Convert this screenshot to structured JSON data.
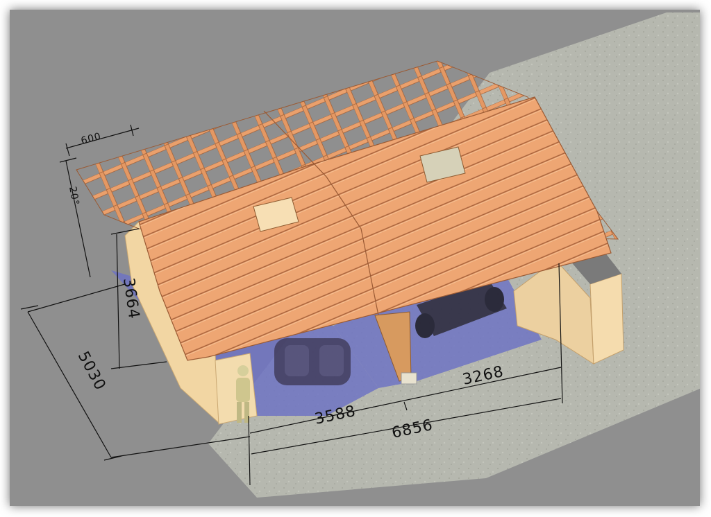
{
  "image": {
    "subject": "garage",
    "dimensions": {
      "rafter_spacing": "600",
      "roof_height": "20°",
      "wall_height": "3664",
      "depth": "5030",
      "left_bay_width": "3588",
      "right_bay_width": "3268",
      "total_width": "6856"
    },
    "colors": {
      "background": "#8f8f8f",
      "concrete": "#b5b7ae",
      "wall": "#f2d6a3",
      "wall_shadow": "#e3bf86",
      "roof": "#e9a06e",
      "floor_zone": "#6f73c3"
    }
  }
}
